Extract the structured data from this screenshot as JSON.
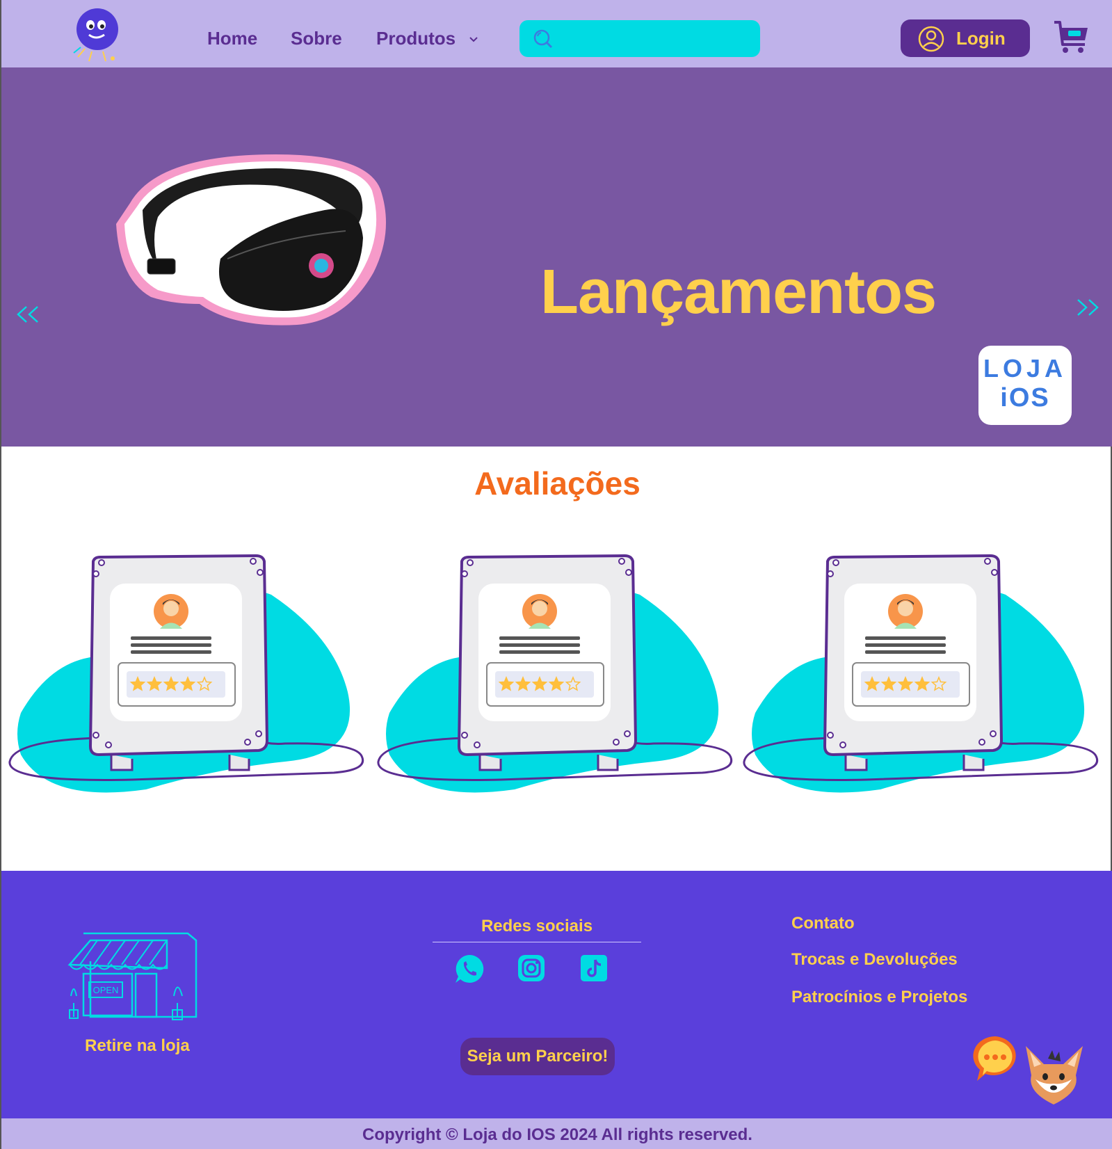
{
  "header": {
    "logo_icon": "smiley-mascot-logo",
    "nav": {
      "home": "Home",
      "sobre": "Sobre",
      "produtos": "Produtos"
    },
    "search": {
      "placeholder": "",
      "value": ""
    },
    "login_label": "Login",
    "cart_icon": "cart-icon"
  },
  "hero": {
    "title": "Lançamentos",
    "badge_line1": "LOJA",
    "badge_line2": "iOS",
    "product_image": "black-waist-bag"
  },
  "reviews": {
    "title": "Avaliações",
    "cards": [
      {
        "rating": 4,
        "max": 5
      },
      {
        "rating": 4,
        "max": 5
      },
      {
        "rating": 4,
        "max": 5
      }
    ]
  },
  "footer": {
    "store_label": "Retire na loja",
    "store_sign": "OPEN",
    "social_title": "Redes sociais",
    "social_icons": [
      "whatsapp-icon",
      "instagram-icon",
      "tiktok-icon"
    ],
    "partner_button": "Seja um Parceiro!",
    "links": {
      "contato": "Contato",
      "trocas": "Trocas e Devoluções",
      "patrocinios": "Patrocínios e Projetos"
    },
    "copyright": "Copyright © Loja do IOS 2024 All rights reserved."
  },
  "colors": {
    "header_bg": "#bfb2ea",
    "hero_bg": "#7957a2",
    "accent_yellow": "#ffd04c",
    "accent_cyan": "#00dbe3",
    "purple_dark": "#5a2d91",
    "footer_bg": "#5a3fdb",
    "reviews_title": "#f36a1d"
  }
}
